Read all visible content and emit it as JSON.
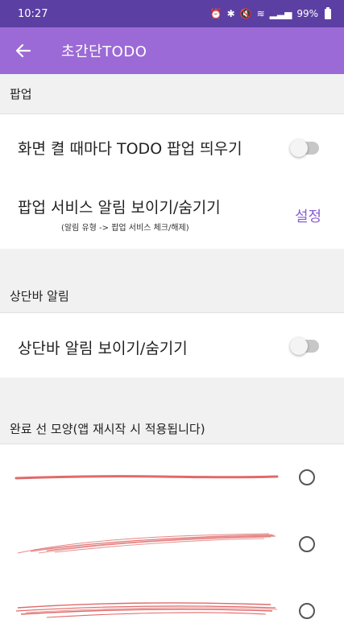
{
  "status_bar": {
    "time": "10:27",
    "icons": [
      "alarm-icon",
      "bluetooth-icon",
      "mute-icon",
      "wifi-icon",
      "signal-icon"
    ],
    "battery": "99%"
  },
  "app_bar": {
    "title": "초간단TODO",
    "back_icon": "arrow-left-icon",
    "background": "#9c6ad6"
  },
  "sections": {
    "popup": {
      "header": "팝업",
      "items": {
        "screen_popup": {
          "label": "화면 켤 때마다 TODO 팝업 띄우기",
          "enabled": false
        },
        "service_notice": {
          "label": "팝업 서비스 알림 보이기/숨기기",
          "sublabel": "(알림 유형 -> 팝업 서비스 체크/해제)",
          "action": "설정"
        }
      }
    },
    "statusbar_notice": {
      "header": "상단바 알림",
      "items": {
        "statusbar_toggle": {
          "label": "상단바 알림 보이기/숨기기",
          "enabled": false
        }
      }
    },
    "line_style": {
      "header": "완료 선 모양(앱 재시작 시 적용됩니다)",
      "options": [
        {
          "style": "straight-line",
          "selected": false
        },
        {
          "style": "scribble-line",
          "selected": false
        },
        {
          "style": "multi-stroke-line",
          "selected": false
        }
      ],
      "stroke_color": "#e06a6a"
    }
  },
  "colors": {
    "status_bar": "#5b3fa3",
    "accent": "#8a5fd0"
  }
}
